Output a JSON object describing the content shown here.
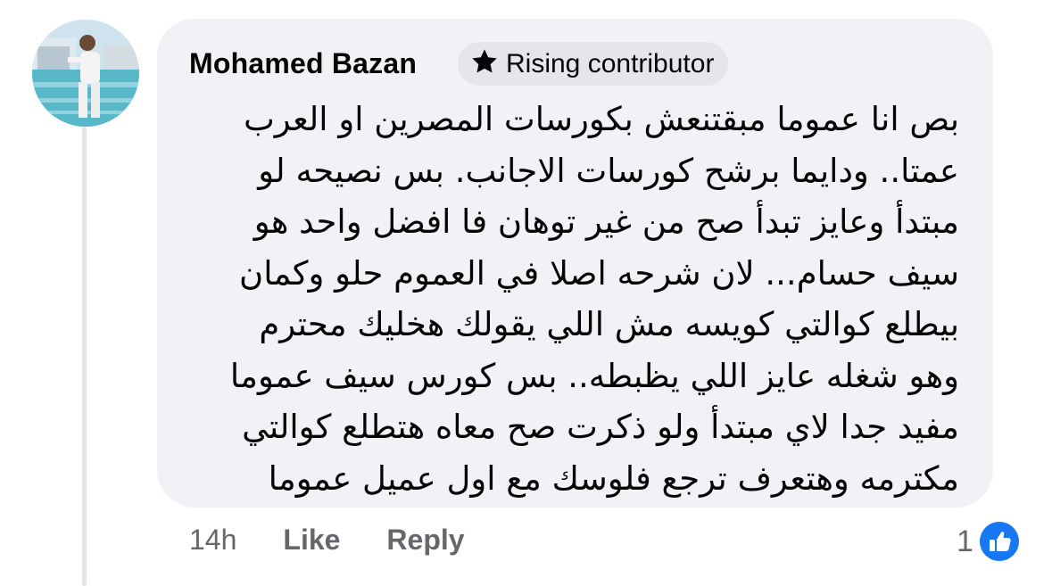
{
  "comment": {
    "author": "Mohamed Bazan",
    "badge": {
      "icon": "star-icon",
      "label": "Rising contributor"
    },
    "lines": [
      "بص انا عموما مبقتنعش بكورسات المصرين او العرب",
      "عمتا..  ودايما برشح كورسات الاجانب. بس نصيحه لو",
      "مبتدأ وعايز تبدأ صح من غير توهان فا افضل واحد هو",
      "سيف حسام... لان شرحه اصلا في العموم حلو وكمان",
      "بيطلع كوالتي كويسه مش اللي يقولك هخليك محترم",
      "وهو شغله عايز اللي يظبطه.. بس كورس سيف عموما",
      "مفيد جدا لاي مبتدأ ولو ذكرت صح معاه هتطلع كوالتي",
      "مكترمه وهتعرف ترجع فلوسك مع اول عميل عموما"
    ]
  },
  "actions": {
    "time": "14h",
    "like_label": "Like",
    "reply_label": "Reply"
  },
  "reactions": {
    "count": "1",
    "icon": "like-thumb-icon",
    "color": "#1877f2"
  }
}
